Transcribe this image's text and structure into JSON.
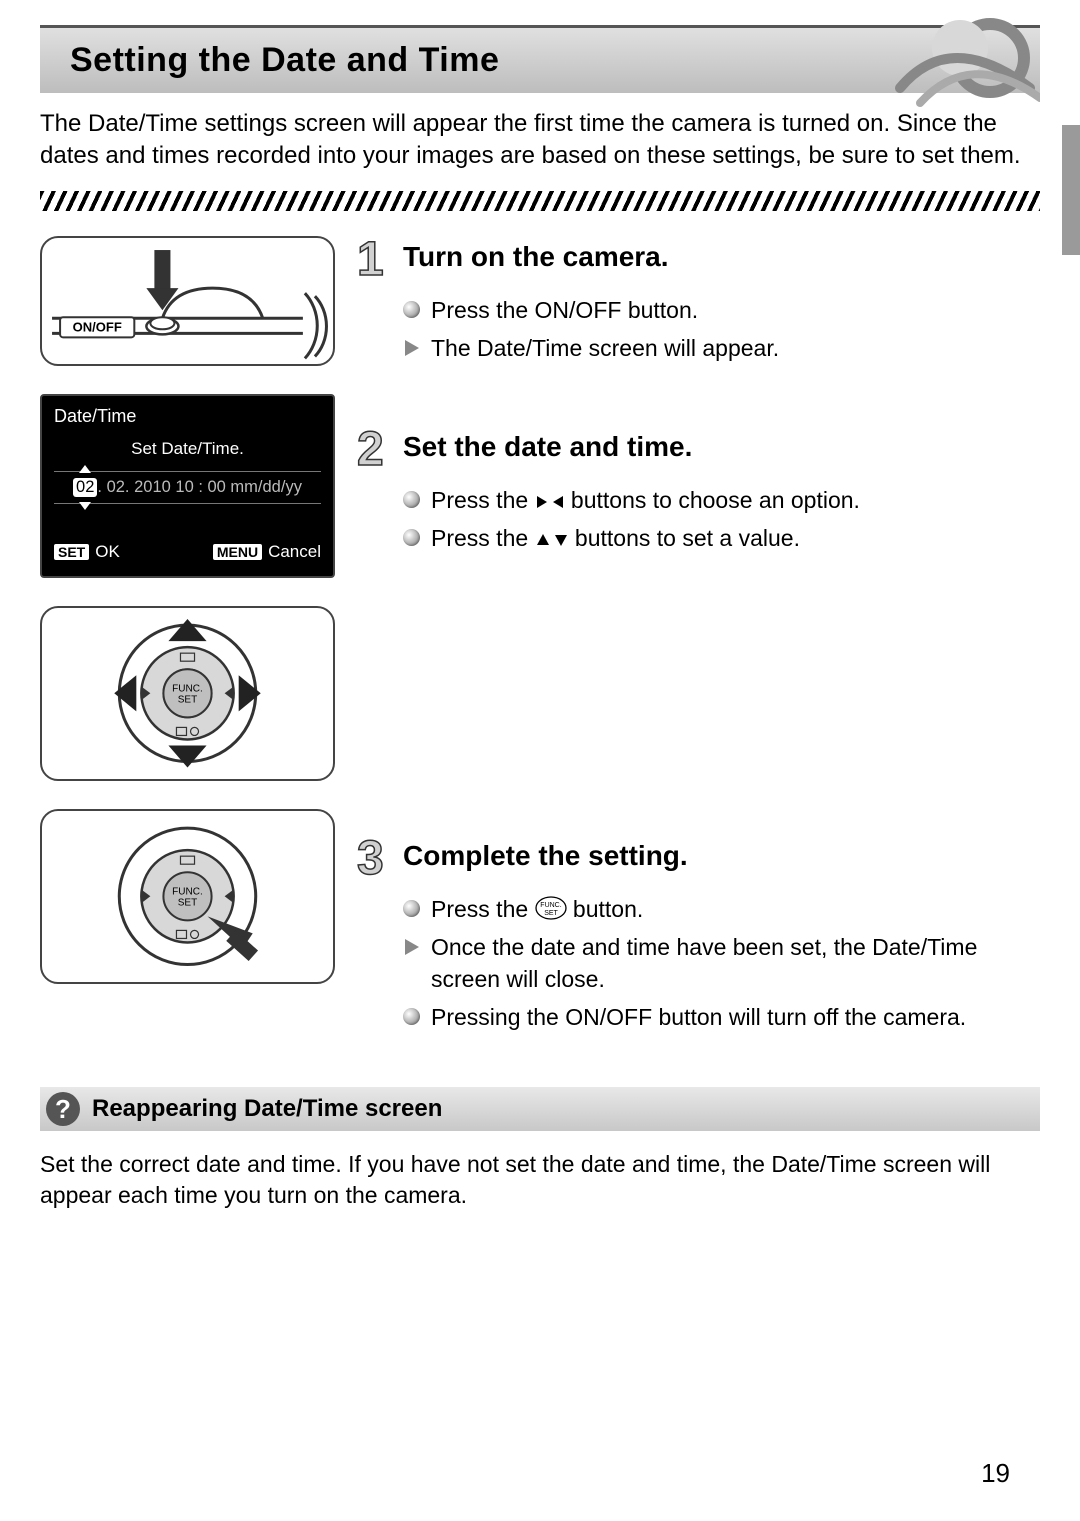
{
  "header": {
    "title": "Setting the Date and Time"
  },
  "intro": "The Date/Time settings screen will appear the first time the camera is turned on. Since the dates and times recorded into your images are based on these settings, be sure to set them.",
  "onoff_label": "ON/OFF",
  "lcd": {
    "title": "Date/Time",
    "subtitle": "Set Date/Time.",
    "sel": "02",
    "rest": ". 02. 2010 10 : 00 mm/dd/yy",
    "set_badge": "SET",
    "ok": "OK",
    "menu_badge": "MENU",
    "cancel": "Cancel"
  },
  "steps": [
    {
      "num": "1",
      "title": "Turn on the camera.",
      "items": [
        {
          "kind": "dot",
          "html": "Press the ON/OFF button."
        },
        {
          "kind": "tri",
          "html": "The Date/Time screen will appear."
        }
      ]
    },
    {
      "num": "2",
      "title": "Set the date and time.",
      "items": [
        {
          "kind": "dot",
          "html": "Press the <svg class='inline-icon' width='30' height='18'><polygon points='12,9 2,3 2,15' fill='#000'/><polygon points='18,9 28,3 28,15' fill='#000'/></svg> buttons to choose an option."
        },
        {
          "kind": "dot",
          "html": "Press the <svg class='inline-icon' width='34' height='18'><polygon points='8,3 2,14 14,14' fill='#000'/><polygon points='26,15 20,4 32,4' fill='#000'/></svg> buttons to set a value."
        }
      ]
    },
    {
      "num": "3",
      "title": "Complete the setting.",
      "items": [
        {
          "kind": "dot",
          "html": "Press the <svg class='inline-icon' width='32' height='24'><ellipse cx='16' cy='12' rx='15' ry='11' fill='none' stroke='#000' stroke-width='1.3'/><text x='16' y='11' font-size='7' text-anchor='middle' font-family='Arial'>FUNC.</text><text x='16' y='19' font-size='7' text-anchor='middle' font-family='Arial'>SET</text></svg> button."
        },
        {
          "kind": "tri",
          "html": "Once the date and time have been set, the Date/Time screen will close."
        },
        {
          "kind": "dot",
          "html": "Pressing the ON/OFF button will turn off the camera."
        }
      ]
    }
  ],
  "note": {
    "title": "Reappearing Date/Time screen",
    "body": "Set the correct date and time. If you have not set the date and time, the Date/Time screen will appear each time you turn on the camera."
  },
  "page_number": "19"
}
